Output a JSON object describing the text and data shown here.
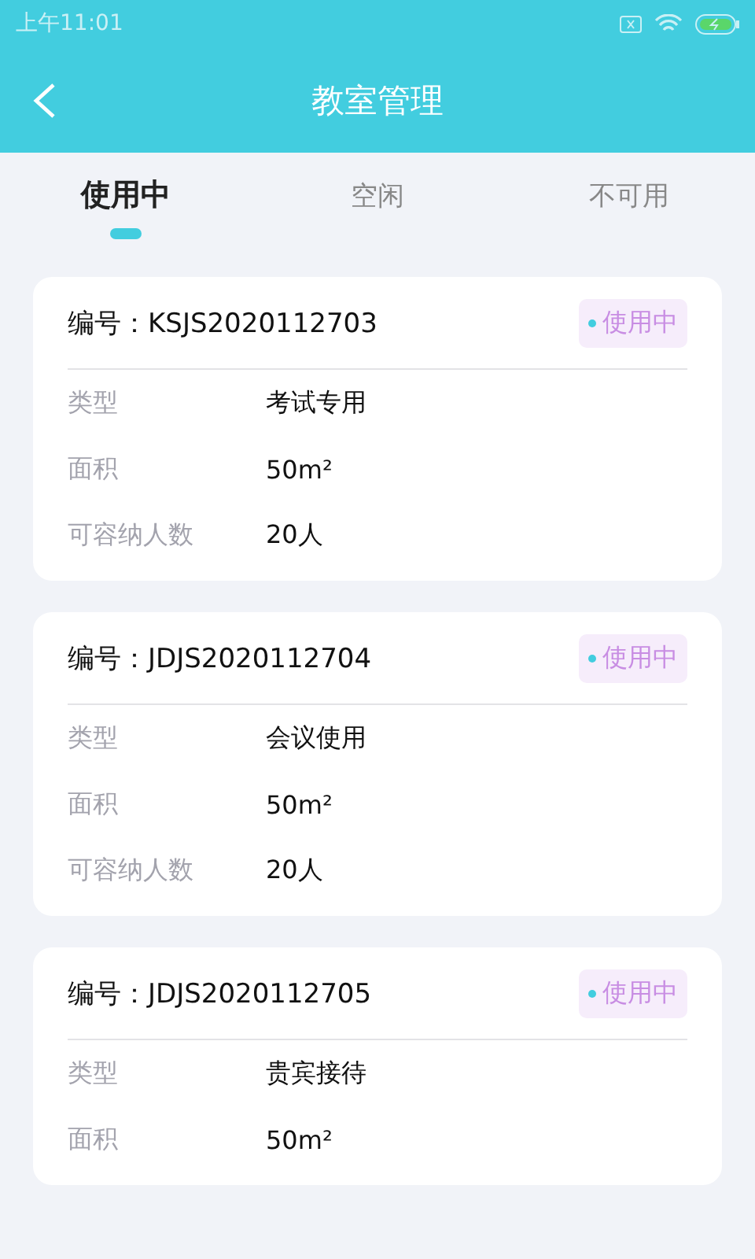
{
  "status_bar": {
    "time": "上午11:01"
  },
  "header": {
    "title": "教室管理"
  },
  "tabs": [
    {
      "label": "使用中",
      "selected": true
    },
    {
      "label": "空闲",
      "selected": false
    },
    {
      "label": "不可用",
      "selected": false
    }
  ],
  "rooms": [
    {
      "code": "编号：KSJS2020112703",
      "status": "使用中",
      "fields": [
        {
          "label": "类型",
          "value": "考试专用"
        },
        {
          "label": "面积",
          "value": "50m²"
        },
        {
          "label": "可容纳人数",
          "value": "20人"
        }
      ]
    },
    {
      "code": "编号：JDJS2020112704",
      "status": "使用中",
      "fields": [
        {
          "label": "类型",
          "value": "会议使用"
        },
        {
          "label": "面积",
          "value": "50m²"
        },
        {
          "label": "可容纳人数",
          "value": "20人"
        }
      ]
    },
    {
      "code": "编号：JDJS2020112705",
      "status": "使用中",
      "fields": [
        {
          "label": "类型",
          "value": "贵宾接待"
        },
        {
          "label": "面积",
          "value": "50m²"
        }
      ]
    }
  ]
}
